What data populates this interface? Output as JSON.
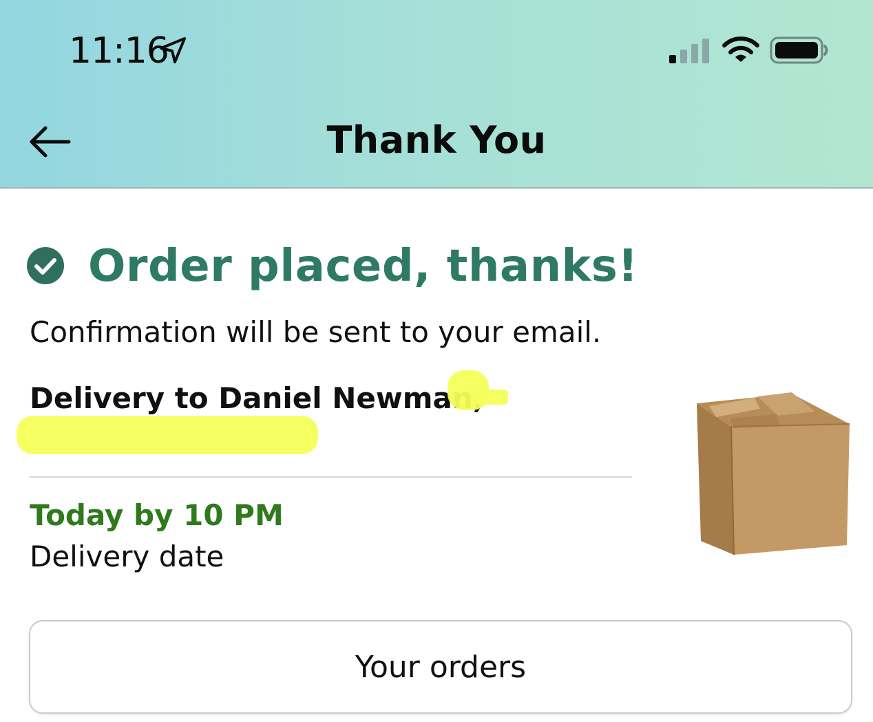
{
  "status_bar": {
    "time": "11:16",
    "icons": [
      "location-arrow-icon",
      "cellular-signal-icon",
      "wifi-icon",
      "battery-icon"
    ]
  },
  "header": {
    "title": "Thank You",
    "back_icon": "back-arrow-icon",
    "gradient_colors": [
      "#93d6e0",
      "#b2e6d1"
    ]
  },
  "confirmation": {
    "title": "Order placed, thanks!",
    "title_icon": "check-circle-icon",
    "title_color": "#2e7a64",
    "subtitle": "Confirmation will be sent to your email."
  },
  "delivery": {
    "recipient_line": "Delivery to Daniel Newman,",
    "eta": "Today by 10 PM",
    "eta_color": "#2f7a1e",
    "eta_label": "Delivery date",
    "image": "cardboard-box-image"
  },
  "actions": {
    "orders_button": "Your orders"
  }
}
